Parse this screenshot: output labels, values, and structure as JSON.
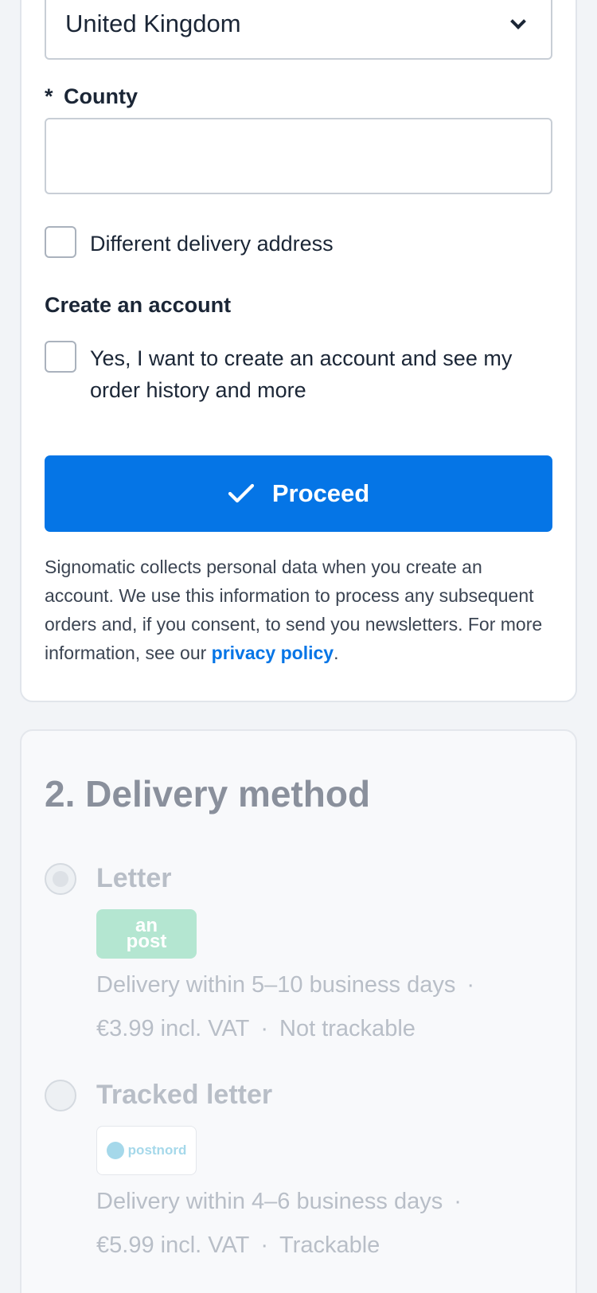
{
  "address": {
    "country_value": "United Kingdom",
    "county_label_prefix": "*",
    "county_label": "County",
    "county_value": "",
    "different_delivery_label": "Different delivery address"
  },
  "account": {
    "section_title": "Create an account",
    "create_checkbox_line1": "Yes, I want to create an account and see my",
    "create_checkbox_line2": "order history and more",
    "proceed_label": "Proceed",
    "notice_text": "Signomatic collects personal data when you create an account. We use this information to process any subsequent orders and, if you consent, to send you newsletters. For more information, see our ",
    "notice_link": "privacy policy",
    "notice_end": "."
  },
  "delivery": {
    "title": "2. Delivery method",
    "methods": [
      {
        "name": "Letter",
        "logo_text_line1": "an",
        "logo_text_line2": "post",
        "delivery_time": "Delivery within 5–10 business days",
        "price": "€3.99 incl. VAT",
        "tracking": "Not trackable",
        "selected": true
      },
      {
        "name": "Tracked letter",
        "logo_text": "postnord",
        "delivery_time": "Delivery within 4–6 business days",
        "price": "€5.99 incl. VAT",
        "tracking": "Trackable",
        "selected": false
      }
    ],
    "separator": "·"
  },
  "colors": {
    "primary": "#0575e6",
    "text": "#1b2636",
    "disabled_text": "#b8bec7",
    "anpost_logo": "#b4e6d1",
    "postnord_logo": "#a5d8ea"
  }
}
